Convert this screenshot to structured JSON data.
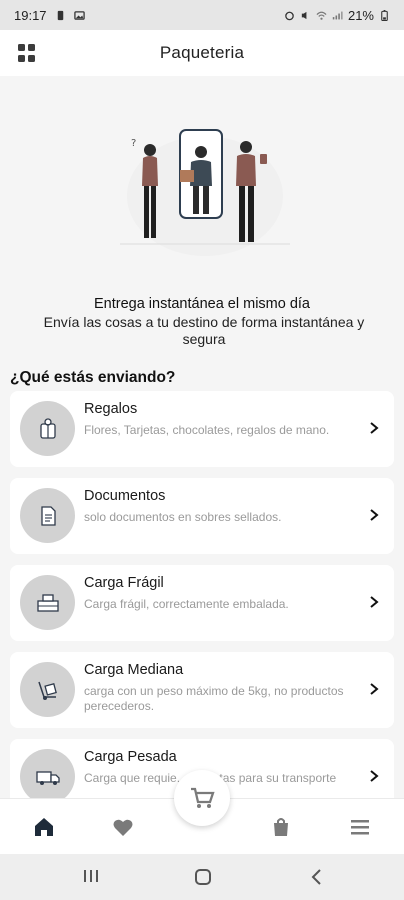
{
  "status_bar": {
    "time": "19:17",
    "battery": "21%",
    "icons": [
      "vibrate-icon",
      "image-icon",
      "alarm-icon",
      "mute-icon",
      "wifi-icon",
      "signal-icon",
      "battery-icon"
    ]
  },
  "app_bar": {
    "title": "Paqueteria",
    "menu_icon": "grid-menu-icon"
  },
  "hero": {
    "title": "Entrega instantánea el mismo día",
    "subtitle": "Envía las cosas a tu destino de forma instantánea y segura"
  },
  "section": {
    "title": "¿Qué estás enviando?"
  },
  "options": [
    {
      "title": "Regalos",
      "description": "Flores, Tarjetas, chocolates, regalos de mano.",
      "icon": "gift-icon"
    },
    {
      "title": "Documentos",
      "description": "solo documentos en sobres sellados.",
      "icon": "document-icon"
    },
    {
      "title": "Carga Frágil",
      "description": "Carga frágil, correctamente embalada.",
      "icon": "fragile-box-icon"
    },
    {
      "title": "Carga Mediana",
      "description": "carga  con un peso máximo de 5kg, no productos perecederos.",
      "icon": "hand-truck-icon"
    },
    {
      "title": "Carga Pesada",
      "description": "Carga que requie...mionetas para su transporte",
      "icon": "truck-icon"
    }
  ],
  "bottom_nav": {
    "items": [
      "home-icon",
      "favorites-icon",
      "cart-icon",
      "shopping-bag-icon",
      "menu-icon"
    ],
    "active": "home-icon"
  },
  "colors": {
    "background": "#f5f5f5",
    "card": "#ffffff",
    "icon_circle": "#d2d2d2",
    "accent_dark": "#2f3a4a"
  }
}
